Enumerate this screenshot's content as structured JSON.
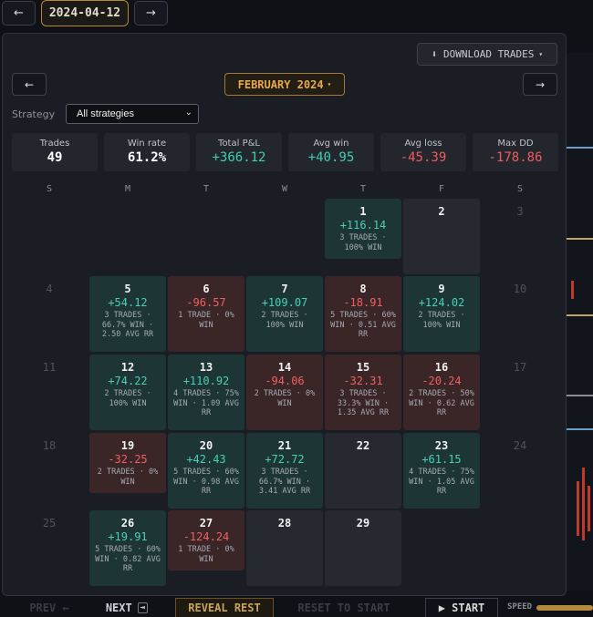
{
  "topbar": {
    "prev": "←",
    "date": "2024-04-12",
    "next": "→"
  },
  "bottombar": {
    "prev": "PREV ←",
    "next": "NEXT",
    "next_icon": "⇥",
    "reveal": "REVEAL REST",
    "reset": "RESET TO START",
    "start": "▶ START",
    "speed": "SPEED"
  },
  "modal": {
    "download": "⬇ DOWNLOAD TRADES",
    "download_caret": "▾",
    "prev_month": "←",
    "next_month": "→",
    "month": "FEBRUARY 2024",
    "month_caret": "▾",
    "strategy_label": "Strategy",
    "strategy_value": "All strategies"
  },
  "stats": [
    {
      "label": "Trades",
      "value": "49"
    },
    {
      "label": "Win rate",
      "value": "61.2%"
    },
    {
      "label": "Total P&L",
      "value": "+366.12"
    },
    {
      "label": "Avg win",
      "value": "+40.95"
    },
    {
      "label": "Avg loss",
      "value": "-45.39"
    },
    {
      "label": "Max DD",
      "value": "-178.86"
    }
  ],
  "weekdays": [
    "S",
    "M",
    "T",
    "W",
    "T",
    "F",
    "S"
  ],
  "weekend_days": [
    "3",
    "4",
    "10",
    "11",
    "17",
    "18",
    "24",
    "25"
  ],
  "days": [
    {
      "day": "1",
      "pnl": "+116.14",
      "detail": "3 TRADES · 100% WIN"
    },
    {
      "day": "2",
      "pnl": "",
      "detail": ""
    },
    {
      "day": "5",
      "pnl": "+54.12",
      "detail": "3 TRADES · 66.7% WIN · 2.50 AVG RR"
    },
    {
      "day": "6",
      "pnl": "-96.57",
      "detail": "1 TRADE · 0% WIN"
    },
    {
      "day": "7",
      "pnl": "+109.07",
      "detail": "2 TRADES · 100% WIN"
    },
    {
      "day": "8",
      "pnl": "-18.91",
      "detail": "5 TRADES · 60% WIN · 0.51 AVG RR"
    },
    {
      "day": "9",
      "pnl": "+124.02",
      "detail": "2 TRADES · 100% WIN"
    },
    {
      "day": "12",
      "pnl": "+74.22",
      "detail": "2 TRADES · 100% WIN"
    },
    {
      "day": "13",
      "pnl": "+110.92",
      "detail": "4 TRADES · 75% WIN · 1.09 AVG RR"
    },
    {
      "day": "14",
      "pnl": "-94.06",
      "detail": "2 TRADES · 0% WIN"
    },
    {
      "day": "15",
      "pnl": "-32.31",
      "detail": "3 TRADES · 33.3% WIN · 1.35 AVG RR"
    },
    {
      "day": "16",
      "pnl": "-20.24",
      "detail": "2 TRADES · 50% WIN · 0.62 AVG RR"
    },
    {
      "day": "19",
      "pnl": "-32.25",
      "detail": "2 TRADES · 0% WIN"
    },
    {
      "day": "20",
      "pnl": "+42.43",
      "detail": "5 TRADES · 60% WIN · 0.98 AVG RR"
    },
    {
      "day": "21",
      "pnl": "+72.72",
      "detail": "3 TRADES · 66.7% WIN · 3.41 AVG RR"
    },
    {
      "day": "22",
      "pnl": "",
      "detail": ""
    },
    {
      "day": "23",
      "pnl": "+61.15",
      "detail": "4 TRADES · 75% WIN · 1.05 AVG RR"
    },
    {
      "day": "26",
      "pnl": "+19.91",
      "detail": "5 TRADES · 60% WIN · 0.82 AVG RR"
    },
    {
      "day": "27",
      "pnl": "-124.24",
      "detail": "1 TRADE · 0% WIN"
    },
    {
      "day": "28",
      "pnl": "",
      "detail": ""
    },
    {
      "day": "29",
      "pnl": "",
      "detail": ""
    }
  ]
}
